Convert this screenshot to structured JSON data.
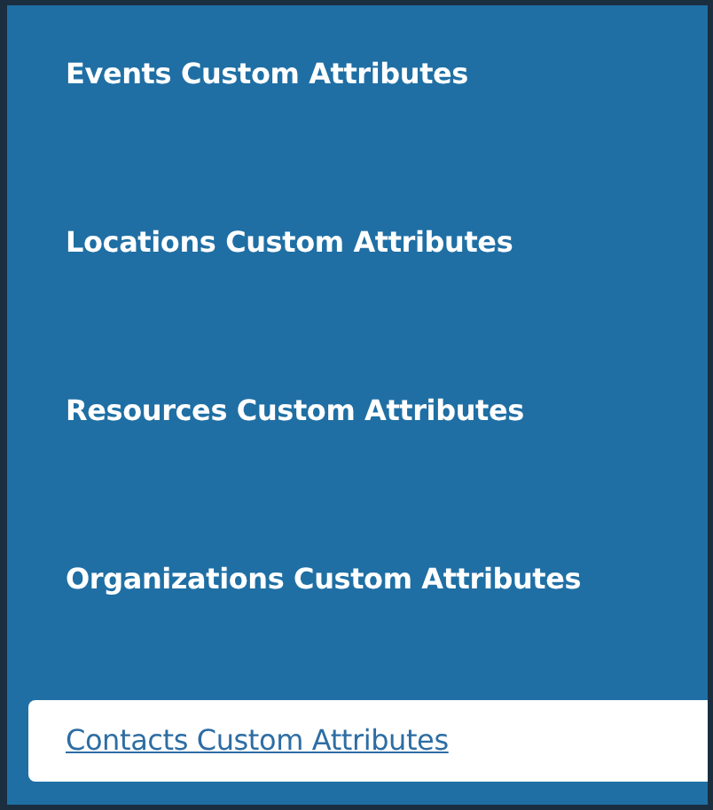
{
  "menu": {
    "items": [
      {
        "label": "Events Custom Attributes",
        "selected": false
      },
      {
        "label": "Locations Custom Attributes",
        "selected": false
      },
      {
        "label": "Resources Custom Attributes",
        "selected": false
      },
      {
        "label": "Organizations Custom Attributes",
        "selected": false
      },
      {
        "label": "Contacts Custom Attributes",
        "selected": true
      }
    ]
  }
}
